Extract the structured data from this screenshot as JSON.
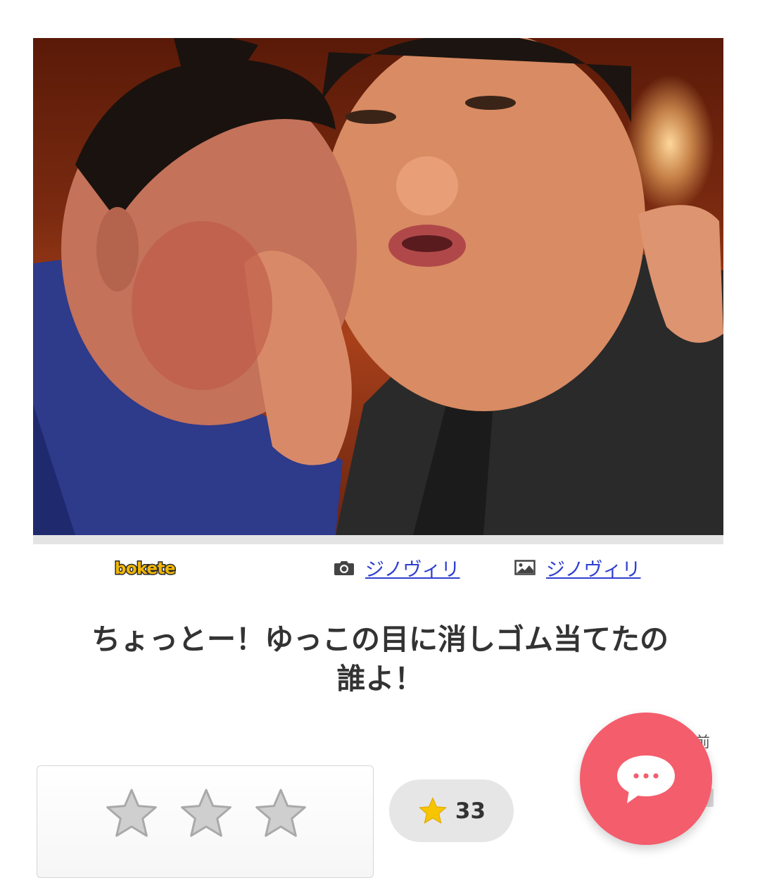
{
  "photo": {
    "alt_subject": "sumo-wrestlers-photo"
  },
  "credits": {
    "logo_text": "bokete",
    "photo_author": "ジノヴィリ",
    "image_author": "ジノヴィリ"
  },
  "caption": {
    "line1": "ちょっとー！ゆっこの目に消しゴム当てたの",
    "line2": "誰よ！"
  },
  "meta": {
    "time_suffix": "前"
  },
  "rating": {
    "stars": 3,
    "selected": 0
  },
  "score": {
    "value": "33"
  },
  "colors": {
    "link": "#2f3fd0",
    "fab": "#f45d6c",
    "score_star": "#f7c400",
    "star_empty": "#cfcfcf"
  },
  "icons": {
    "camera": "camera-icon",
    "image": "image-icon",
    "star": "star-icon",
    "comment": "comment-bubble-icon"
  }
}
